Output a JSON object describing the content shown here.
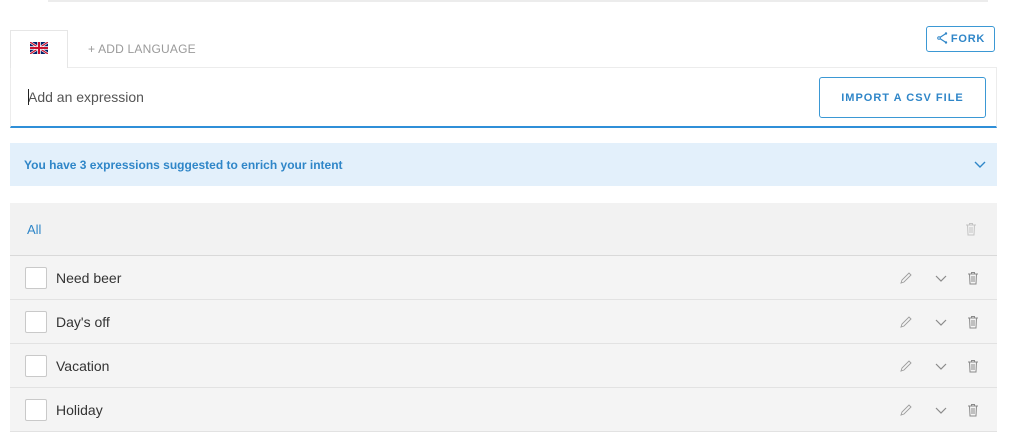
{
  "header": {
    "fork_label": "FORK"
  },
  "tabs": {
    "add_language_label": "+ ADD LANGUAGE"
  },
  "expression": {
    "placeholder": "Add an expression",
    "import_label": "IMPORT A CSV FILE"
  },
  "suggestions": {
    "text": "You have 3 expressions suggested to enrich your intent"
  },
  "list": {
    "all_label": "All",
    "rows": [
      {
        "text": "Need beer"
      },
      {
        "text": "Day's off"
      },
      {
        "text": "Vacation"
      },
      {
        "text": "Holiday"
      }
    ]
  },
  "colors": {
    "accent": "#2f86c8",
    "suggest_bg": "#e3f0fb",
    "list_bg": "#f4f4f4"
  },
  "icons": {
    "fork": "fork-icon",
    "flag": "uk-flag-icon",
    "chevron": "chevron-down-icon",
    "edit": "pencil-icon",
    "delete": "trash-icon"
  }
}
